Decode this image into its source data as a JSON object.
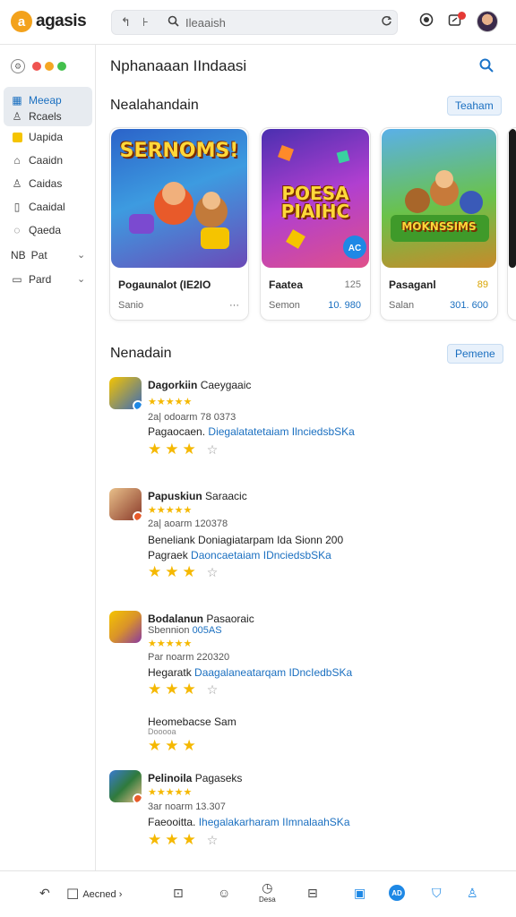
{
  "header": {
    "logo_letter": "a",
    "logo_text": "agasis",
    "search_placeholder": "Ileaaish",
    "search_left_icons": [
      "↰",
      "⊦"
    ],
    "icons": [
      "reload-icon",
      "circle-icon",
      "notification-icon"
    ]
  },
  "sidebar": {
    "traffic_colors": [
      "#ef5350",
      "#f5a623",
      "#43c04c"
    ],
    "items": [
      {
        "label": "Meeap",
        "icon": "grid-icon",
        "active": true
      },
      {
        "label": "Rcaels",
        "icon": "user-icon",
        "active": true
      },
      {
        "label": "Uapida",
        "icon": "square-icon"
      },
      {
        "label": "Caaidn",
        "icon": "home-icon"
      },
      {
        "label": "Caidas",
        "icon": "person-icon"
      },
      {
        "label": "Caaidal",
        "icon": "bookmark-icon"
      },
      {
        "label": "Qaeda",
        "icon": "tag-icon"
      },
      {
        "label": "Pat",
        "prefix": "NB",
        "icon": "chevron-down-icon"
      },
      {
        "label": "Pard",
        "icon": "folder-icon"
      }
    ]
  },
  "main": {
    "title": "Nphanaaan IIndaasi",
    "section1": {
      "title": "Nealahandain",
      "button": "Teaham"
    },
    "cards": [
      {
        "art_text": "SERNOMS!",
        "name": "Pogaunalot (IE2IO",
        "value": "",
        "sub": "Sanio",
        "price": "···",
        "bg": "#3a6fd8"
      },
      {
        "art_text": "POESA PIAIHC",
        "name": "Faatea",
        "value": "125",
        "sub": "Semon",
        "price": "10. 980",
        "bg": "#7a3fd0"
      },
      {
        "art_text": "MOKNSSIMS",
        "name": "Pasaganl",
        "value": "89",
        "sub": "Salan",
        "price": "301. 600",
        "bg": "#3f9a4a"
      }
    ],
    "section2": {
      "title": "Nenadain",
      "button": "Pemene"
    },
    "reviews": [
      {
        "name": "Dagorkiin",
        "tag": "Caeygaaic",
        "stars": "★★★★★",
        "meta": "2a| odoarm  78 0373",
        "text_plain": "Pagaocaen.",
        "text_link": "Diegalatatetaiam IlnciedsbSKa",
        "rating": "★★★",
        "has_empty": true,
        "icon_bg": "#3c6bb8"
      },
      {
        "name": "Papuskiun",
        "tag": "Saraacic",
        "stars": "★★★★★",
        "meta": "2a| aoarm  120378",
        "text_plain": "Beneliank Doniagiatarpam Ida Sionn 200",
        "text_plain2": "Pagraek",
        "text_link": "Daoncaetaiam IDnciedsbSKa",
        "rating": "★★★",
        "has_empty": true,
        "icon_bg": "#8a3a2a"
      },
      {
        "name": "Bodalanun",
        "tag": "Pasaoraic",
        "stars": "★★★★★",
        "meta": "Sbennion",
        "meta_link": "005AS",
        "meta2": "Par noarm  220320",
        "text_plain": "Hegaratk",
        "text_link": "Daagalaneatarqam IDncIedbSKa",
        "rating": "★★★",
        "has_empty": true,
        "icon_bg": "#d9932a"
      },
      {
        "name": "Heomebacse Sam",
        "tag": "",
        "stars": "",
        "meta": "Dooooa",
        "text_plain": "",
        "text_link": "",
        "rating": "★★★",
        "has_empty": false,
        "icon_bg": ""
      },
      {
        "name": "Pelinoila",
        "tag": "Pagaseks",
        "stars": "★★★★★",
        "meta": "3ar noarm  13.307",
        "text_plain": "Faeooitta.",
        "text_link": "Ihegalakarharam IImnalaahSKa",
        "rating": "★★★",
        "has_empty": true,
        "icon_bg": "#2f7a3c"
      }
    ]
  },
  "bottom": {
    "items": [
      {
        "icon": "back-icon",
        "glyph": "↶"
      },
      {
        "icon": "checkbox-icon",
        "glyph": "☐",
        "label": "Aecned ›"
      },
      {
        "icon": "comment-icon",
        "glyph": "⊡"
      },
      {
        "icon": "emoji-icon",
        "glyph": "☺"
      },
      {
        "icon": "clock-icon",
        "glyph": "◷",
        "label": "Desa"
      },
      {
        "icon": "album-icon",
        "glyph": "⊟"
      },
      {
        "icon": "badge-app-icon",
        "glyph": "▣"
      },
      {
        "icon": "ad-icon",
        "glyph": "AD"
      },
      {
        "icon": "shield-icon",
        "glyph": "⛉"
      },
      {
        "icon": "person-icon",
        "glyph": "♙"
      }
    ]
  }
}
